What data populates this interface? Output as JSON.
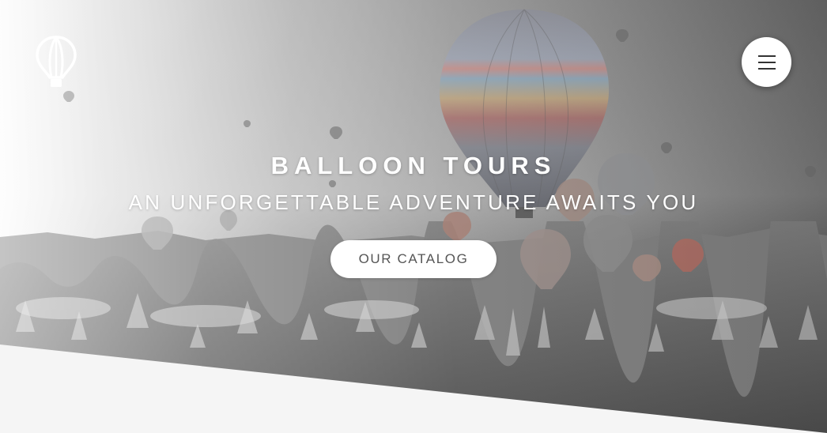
{
  "hero": {
    "title": "BALLOON TOURS",
    "subtitle": "AN UNFORGETTABLE ADVENTURE AWAITS YOU",
    "cta_label": "OUR CATALOG",
    "background": "hot-air-balloons-over-rocky-valley-photo"
  },
  "header": {
    "logo_icon": "hot-air-balloon-icon",
    "menu_icon": "hamburger-menu-icon"
  },
  "colors": {
    "text_on_hero": "#ffffff",
    "button_bg": "#ffffff",
    "button_text": "#555555",
    "page_bg": "#f5f5f5"
  }
}
